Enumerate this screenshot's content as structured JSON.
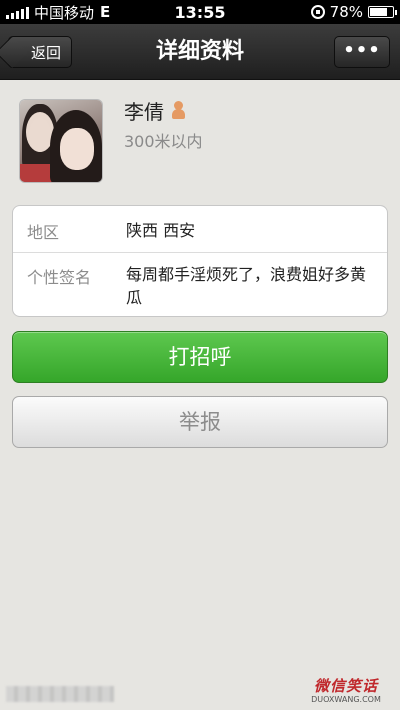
{
  "status_bar": {
    "carrier": "中国移动",
    "network": "E",
    "time": "13:55",
    "battery": "78%",
    "battery_level": 0.78
  },
  "nav": {
    "back_label": "返回",
    "title": "详细资料",
    "more_label": "•••"
  },
  "profile": {
    "name": "李倩",
    "gender_icon": "female-icon",
    "distance": "300米以内"
  },
  "info": {
    "region_label": "地区",
    "region_value": "陕西 西安",
    "signature_label": "个性签名",
    "signature_value": "每周都手淫烦死了，浪费姐好多黄瓜"
  },
  "actions": {
    "greet_label": "打招呼",
    "report_label": "举报"
  },
  "watermark": {
    "main": "微信笑话",
    "sub": "DUOXWANG.COM"
  },
  "colors": {
    "accent_green": "#3fb233",
    "nav_dark": "#2a2a2a",
    "background": "#e6e5e1"
  }
}
